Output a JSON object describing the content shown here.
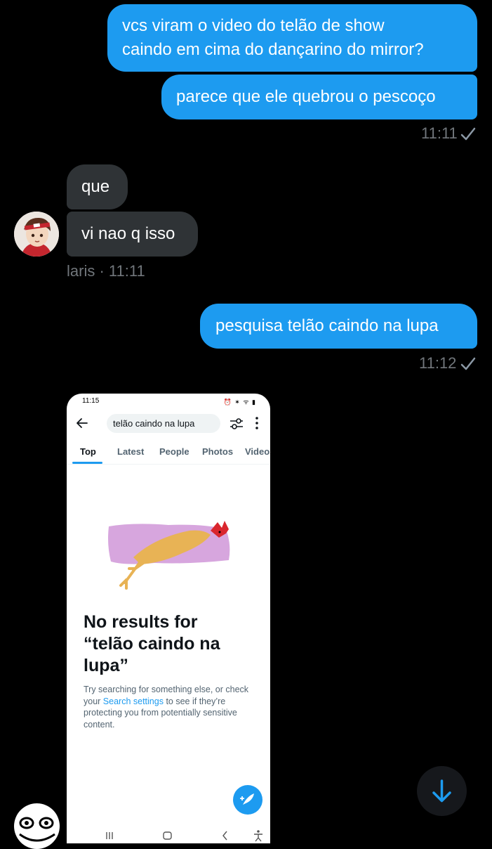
{
  "messages": {
    "m1_line1": "vcs viram o video do telão de show",
    "m1_line2": "caindo em cima do dançarino do mirror?",
    "m2": "parece que ele quebrou o pescoço",
    "m2_time": "11:11",
    "r1": "que",
    "r2": "vi nao q isso",
    "r_meta": "laris · 11:11",
    "m3": "pesquisa telão caindo na lupa",
    "m3_time": "11:12"
  },
  "attachment": {
    "status_time": "11:15",
    "status_icons": "⏰ ✶ ᯤ ▮",
    "search_value": "telão caindo na lupa",
    "tabs": [
      "Top",
      "Latest",
      "People",
      "Photos",
      "Videos"
    ],
    "no_results_line1": "No results for",
    "no_results_line2": "“telão caindo na",
    "no_results_line3": "lupa”",
    "sub_part1": "Try searching for something else, or check your ",
    "sub_link": "Search settings",
    "sub_part2": " to see if they’re protecting you from potentially sensitive content."
  },
  "colors": {
    "outgoing_bubble": "#1d9bf0",
    "incoming_bubble": "#2f3336",
    "meta_text": "#71767b",
    "background": "#000000"
  },
  "icons": [
    "check-icon",
    "back-arrow-icon",
    "filter-icon",
    "more-icon",
    "compose-icon",
    "arrow-down-icon"
  ]
}
